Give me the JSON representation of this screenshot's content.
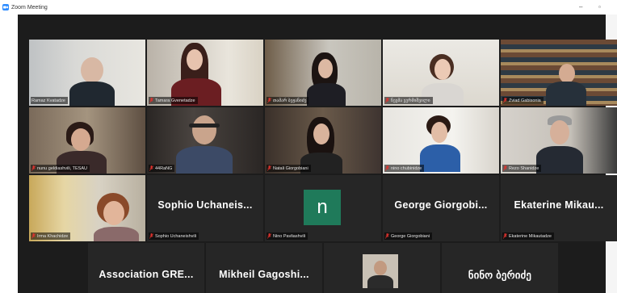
{
  "window": {
    "title": "Zoom Meeting",
    "minimize": "–",
    "restore": "▫"
  },
  "colors": {
    "active_speaker": "#d8e23c",
    "muted_mic": "#e0332e",
    "avatar_bg": "#1f7a5a"
  },
  "tiles": [
    {
      "name": "Ramaz Kvatadze",
      "muted": false
    },
    {
      "name": "Tamara Gvenetadze",
      "muted": true
    },
    {
      "name": "თამარ ბეჟანიძე",
      "muted": true
    },
    {
      "name": "ნევმა ვერმიშვილი",
      "muted": true
    },
    {
      "name": "Zviad Gabisonia",
      "muted": true
    },
    {
      "name": "nunu geldiashvili, TESAU",
      "muted": true
    },
    {
      "name": "44RaNG",
      "muted": true
    },
    {
      "name": "Natali Giorgobiani",
      "muted": true
    },
    {
      "name": "nino chubinidze",
      "muted": true
    },
    {
      "name": "Rezo Shanidze",
      "muted": true
    },
    {
      "name": "Irma Khachidze",
      "muted": true
    },
    {
      "name": "Sophio Uchaneishvili",
      "display": "Sophio Uchaneis...",
      "muted": true
    },
    {
      "name": "Nino Pavliashvili",
      "avatar_letter": "n",
      "muted": true
    },
    {
      "name": "George Giorgobiani",
      "display": "George Giorgobi...",
      "muted": true
    },
    {
      "name": "Ekaterine Mikautadze",
      "display": "Ekaterine Mikau...",
      "muted": true
    },
    {
      "display": "Association GRE..."
    },
    {
      "display": "Mikheil Gagoshi..."
    },
    {
      "display": ""
    },
    {
      "display": "ნინო ბერიძე"
    }
  ]
}
